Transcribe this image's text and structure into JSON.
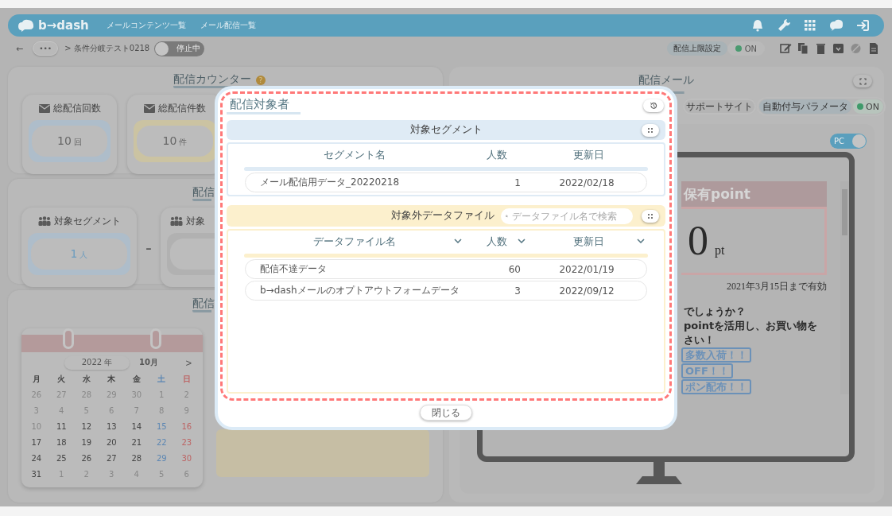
{
  "header": {
    "logo": "b→dash",
    "nav": [
      {
        "label": "メールコンテンツ一覧"
      },
      {
        "label": "メール配信一覧"
      }
    ]
  },
  "toolbar": {
    "back": "←",
    "more": "•••",
    "breadcrumb": "> 条件分岐テスト0218",
    "status_toggle": {
      "label": "停止中",
      "on": false
    },
    "limit_button": "配信上限設定",
    "limit_toggle": {
      "label": "ON",
      "on": true
    }
  },
  "counter_panel": {
    "title": "配信カウンター",
    "help": "?",
    "cards": [
      {
        "label": "総配信回数",
        "value": "10",
        "unit": "回",
        "color": "#aebdca"
      },
      {
        "label": "総配信件数",
        "value": "10",
        "unit": "件",
        "color": "#cbc3a2"
      }
    ]
  },
  "target_panel": {
    "title": "配信",
    "operator": "-",
    "cards": [
      {
        "label": "対象セグメント",
        "value": "1",
        "unit": "人",
        "color": "#aebdca"
      },
      {
        "label": "対象",
        "color": "#b1b1b1"
      }
    ]
  },
  "schedule_panel": {
    "title": "配信",
    "calendar": {
      "year": "2022 年",
      "month": "10月",
      "next": ">",
      "weekdays": [
        {
          "label": "月",
          "kind": "normal"
        },
        {
          "label": "火",
          "kind": "normal"
        },
        {
          "label": "水",
          "kind": "normal"
        },
        {
          "label": "木",
          "kind": "normal"
        },
        {
          "label": "金",
          "kind": "normal"
        },
        {
          "label": "土",
          "kind": "sat"
        },
        {
          "label": "日",
          "kind": "sun"
        }
      ],
      "days": [
        {
          "label": "26",
          "kind": "muted"
        },
        {
          "label": "27",
          "kind": "muted"
        },
        {
          "label": "28",
          "kind": "muted"
        },
        {
          "label": "29",
          "kind": "muted"
        },
        {
          "label": "30",
          "kind": "muted"
        },
        {
          "label": "1",
          "kind": "muted"
        },
        {
          "label": "2",
          "kind": "muted"
        },
        {
          "label": "3",
          "kind": "muted"
        },
        {
          "label": "4",
          "kind": "muted"
        },
        {
          "label": "5",
          "kind": "muted"
        },
        {
          "label": "6",
          "kind": "muted"
        },
        {
          "label": "7",
          "kind": "muted"
        },
        {
          "label": "8",
          "kind": "muted"
        },
        {
          "label": "9",
          "kind": "muted"
        },
        {
          "label": "10",
          "kind": "muted"
        },
        {
          "label": "11",
          "kind": "normal"
        },
        {
          "label": "12",
          "kind": "normal"
        },
        {
          "label": "13",
          "kind": "normal"
        },
        {
          "label": "14",
          "kind": "normal"
        },
        {
          "label": "15",
          "kind": "sat"
        },
        {
          "label": "16",
          "kind": "sun"
        },
        {
          "label": "17",
          "kind": "normal"
        },
        {
          "label": "18",
          "kind": "normal"
        },
        {
          "label": "19",
          "kind": "normal"
        },
        {
          "label": "20",
          "kind": "normal"
        },
        {
          "label": "21",
          "kind": "normal"
        },
        {
          "label": "22",
          "kind": "sat"
        },
        {
          "label": "23",
          "kind": "sun"
        },
        {
          "label": "24",
          "kind": "normal"
        },
        {
          "label": "25",
          "kind": "normal"
        },
        {
          "label": "26",
          "kind": "normal"
        },
        {
          "label": "27",
          "kind": "normal"
        },
        {
          "label": "28",
          "kind": "normal"
        },
        {
          "label": "29",
          "kind": "sat"
        },
        {
          "label": "30",
          "kind": "sun"
        },
        {
          "label": "31",
          "kind": "normal"
        },
        {
          "label": "1",
          "kind": "muted"
        },
        {
          "label": "2",
          "kind": "muted"
        },
        {
          "label": "3",
          "kind": "muted"
        },
        {
          "label": "4",
          "kind": "muted"
        },
        {
          "label": "5",
          "kind": "muted"
        },
        {
          "label": "6",
          "kind": "muted"
        }
      ]
    }
  },
  "mail_panel": {
    "title": "配信メール",
    "support_chip": "サポートサイト",
    "param_chip": "自動付与パラメータ",
    "param_toggle": {
      "label": "ON",
      "on": true
    },
    "device_toggle": {
      "label": "PC",
      "on": true
    },
    "preview": {
      "banner": "保有point",
      "points": "0",
      "unit": "pt",
      "expiry": "2021年3月15日まで有効",
      "lines": [
        "でしょうか？",
        "pointを活用し、お買い物を",
        "さい！"
      ],
      "links": [
        "多数入荷！！",
        "OFF！！",
        "ポン配布！！"
      ]
    }
  },
  "modal": {
    "title": "配信対象者",
    "segment": {
      "title": "対象セグメント",
      "columns": [
        "セグメント名",
        "人数",
        "更新日"
      ],
      "rows": [
        [
          "メール配信用データ_20220218",
          "1",
          "2022/02/18"
        ]
      ]
    },
    "excluded": {
      "title": "対象外データファイル",
      "search": {
        "placeholder": "データファイル名で検索"
      },
      "columns": [
        "データファイル名",
        "人数",
        "更新日"
      ],
      "rows": [
        [
          "配信不達データ",
          "60",
          "2022/01/19"
        ],
        [
          "b→dashメールのオプトアウトフォームデータ",
          "3",
          "2022/09/12"
        ]
      ]
    },
    "close": "閉じる"
  }
}
